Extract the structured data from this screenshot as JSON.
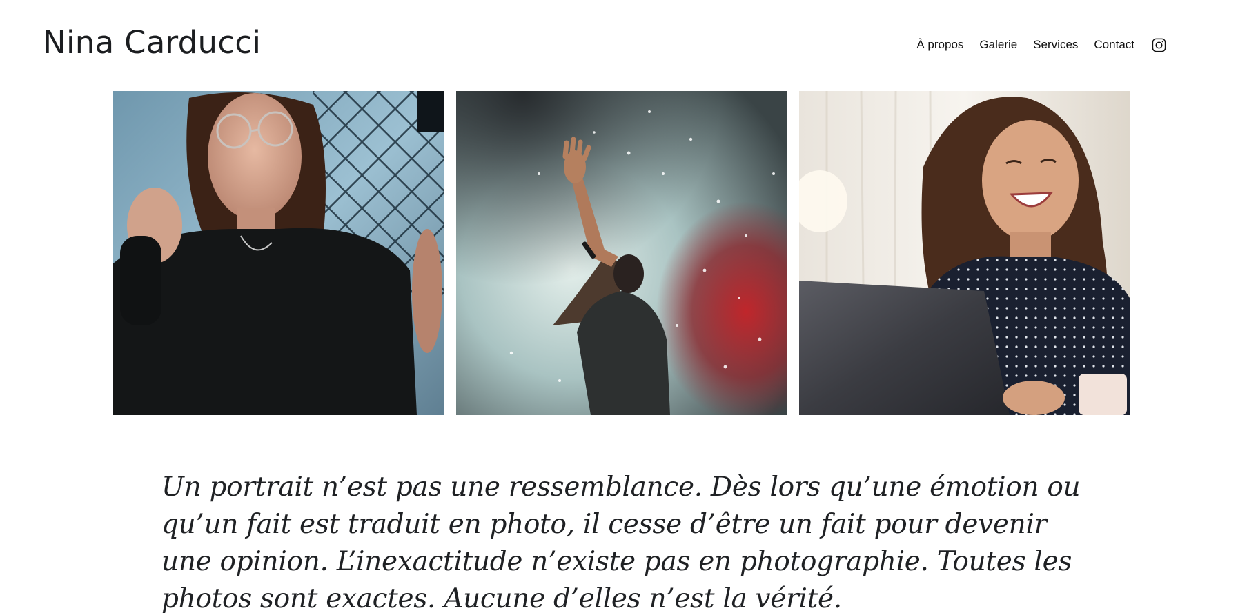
{
  "site": {
    "title": "Nina Carducci"
  },
  "nav": {
    "items": [
      "À propos",
      "Galerie",
      "Services",
      "Contact"
    ],
    "instagram_icon": "instagram-icon"
  },
  "gallery": {
    "photos": [
      {
        "subject": "portrait woman glasses fence",
        "icon": "photo"
      },
      {
        "subject": "concert performer raised hand smoke",
        "icon": "photo"
      },
      {
        "subject": "smiling woman with laptop",
        "icon": "photo"
      }
    ]
  },
  "quote": {
    "text": "Un portrait n’est pas une ressemblance. Dès lors qu’une émotion ou qu’un fait est traduit en photo, il cesse d’être un fait pour devenir une opinion. L’inexactitude n’existe pas en photographie. Toutes les photos sont exactes. Aucune d’elles n’est la vérité."
  },
  "colors": {
    "text": "#1f2124",
    "background": "#ffffff"
  }
}
